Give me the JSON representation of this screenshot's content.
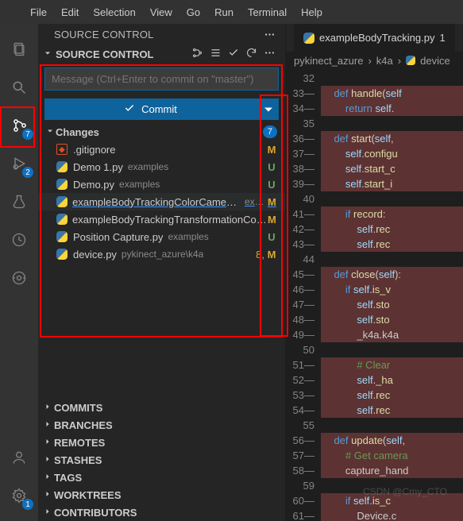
{
  "menu": {
    "items": [
      "File",
      "Edit",
      "Selection",
      "View",
      "Go",
      "Run",
      "Terminal",
      "Help"
    ]
  },
  "activity": {
    "scm_badge": "7",
    "debug_badge": "2",
    "settings_badge": "1"
  },
  "panel": {
    "title": "SOURCE CONTROL",
    "section_title": "SOURCE CONTROL",
    "message_placeholder": "Message (Ctrl+Enter to commit on \"master\")",
    "commit_label": "Commit",
    "changes_label": "Changes",
    "changes_count": "7",
    "files": [
      {
        "name": ".gitignore",
        "dir": "",
        "status": "M",
        "stype": "m",
        "icon": "git"
      },
      {
        "name": "Demo 1.py",
        "dir": "examples",
        "status": "U",
        "stype": "u",
        "icon": "py"
      },
      {
        "name": "Demo.py",
        "dir": "examples",
        "status": "U",
        "stype": "u",
        "icon": "py"
      },
      {
        "name": "exampleBodyTrackingColorCamera.py",
        "dir": "exa...",
        "status": "M",
        "stype": "m",
        "icon": "py",
        "hl": true
      },
      {
        "name": "exampleBodyTrackingTransformationComp...",
        "dir": "",
        "status": "M",
        "stype": "m",
        "icon": "py"
      },
      {
        "name": "Position Capture.py",
        "dir": "examples",
        "status": "U",
        "stype": "u",
        "icon": "py"
      },
      {
        "name": "device.py",
        "dir": "pykinect_azure\\k4a",
        "status": "M",
        "stype": "m",
        "icon": "py",
        "num": "8,"
      }
    ],
    "sections": [
      "COMMITS",
      "BRANCHES",
      "REMOTES",
      "STASHES",
      "TAGS",
      "WORKTREES",
      "CONTRIBUTORS"
    ]
  },
  "editor": {
    "tab_name": "exampleBodyTracking.py",
    "tab_modified": "1",
    "breadcrumb": [
      "pykinect_azure",
      "k4a",
      "device"
    ],
    "lines": [
      {
        "n": "32",
        "t": ""
      },
      {
        "n": "33",
        "t": "    def handle(self",
        "m": 1,
        "d": 1
      },
      {
        "n": "34",
        "t": "        return self.",
        "m": 1,
        "d": 1
      },
      {
        "n": "35",
        "t": ""
      },
      {
        "n": "36",
        "t": "    def start(self, ",
        "m": 1,
        "d": 1
      },
      {
        "n": "37",
        "t": "        self.configu",
        "m": 1,
        "d": 1
      },
      {
        "n": "38",
        "t": "        self.start_c",
        "m": 1,
        "d": 1
      },
      {
        "n": "39",
        "t": "        self.start_i",
        "m": 1,
        "d": 1
      },
      {
        "n": "40",
        "t": ""
      },
      {
        "n": "41",
        "t": "        if record:",
        "m": 1,
        "d": 1
      },
      {
        "n": "42",
        "t": "            self.rec",
        "m": 1,
        "d": 1
      },
      {
        "n": "43",
        "t": "            self.rec",
        "m": 1,
        "d": 1
      },
      {
        "n": "44",
        "t": ""
      },
      {
        "n": "45",
        "t": "    def close(self):",
        "m": 1,
        "d": 1
      },
      {
        "n": "46",
        "t": "        if self.is_v",
        "m": 1,
        "d": 1
      },
      {
        "n": "47",
        "t": "            self.sto",
        "m": 1,
        "d": 1
      },
      {
        "n": "48",
        "t": "            self.sto",
        "m": 1,
        "d": 1
      },
      {
        "n": "49",
        "t": "            _k4a.k4a",
        "m": 1,
        "d": 1
      },
      {
        "n": "50",
        "t": ""
      },
      {
        "n": "51",
        "t": "            # Clear ",
        "m": 1,
        "d": 1
      },
      {
        "n": "52",
        "t": "            self._ha",
        "m": 1,
        "d": 1
      },
      {
        "n": "53",
        "t": "            self.rec",
        "m": 1,
        "d": 1
      },
      {
        "n": "54",
        "t": "            self.rec",
        "m": 1,
        "d": 1
      },
      {
        "n": "55",
        "t": ""
      },
      {
        "n": "56",
        "t": "    def update(self,",
        "m": 1,
        "d": 1
      },
      {
        "n": "57",
        "t": "        # Get camera",
        "m": 1,
        "d": 1
      },
      {
        "n": "58",
        "t": "        capture_hand",
        "m": 1,
        "d": 1
      },
      {
        "n": "59",
        "t": ""
      },
      {
        "n": "60",
        "t": "        if self.is_c",
        "m": 1,
        "d": 1
      },
      {
        "n": "61",
        "t": "            Device.c",
        "m": 1,
        "d": 1
      }
    ]
  },
  "watermark": "CSDN @Cmy_CTO"
}
